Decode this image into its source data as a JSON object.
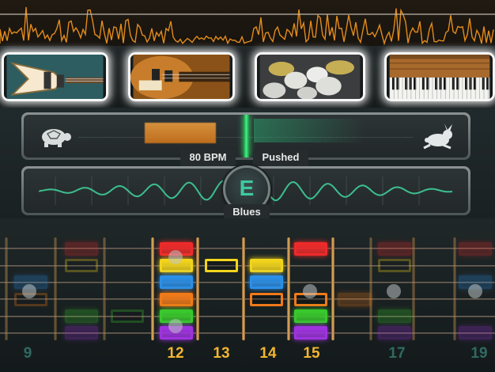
{
  "tempo": {
    "bpm_label": "80 BPM",
    "feel_label": "Pushed"
  },
  "key": {
    "root": "E",
    "scale": "Blues"
  },
  "frets": [
    "9",
    "12",
    "13",
    "14",
    "15",
    "17",
    "19"
  ],
  "colors": {
    "red": "#ee2a2a",
    "yellow": "#f2d41c",
    "blue": "#2b8fe6",
    "orange": "#f07a19",
    "green": "#39c82d",
    "purple": "#9e33de",
    "fret_number": "#f2b630",
    "accent_green": "#3ddc75"
  },
  "instruments": [
    "guitar-icon",
    "bass-icon",
    "drums-icon",
    "keyboard-icon"
  ],
  "icons": [
    "turtle-icon",
    "rabbit-icon"
  ]
}
